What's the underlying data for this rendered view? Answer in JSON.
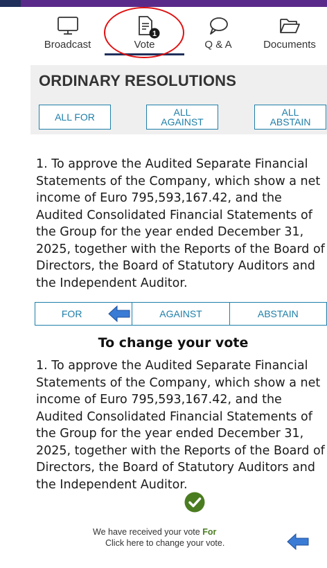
{
  "nav": {
    "items": [
      {
        "label": "Broadcast",
        "icon": "monitor-icon"
      },
      {
        "label": "Vote",
        "icon": "document-icon",
        "badge": "1",
        "active": true
      },
      {
        "label": "Q & A",
        "icon": "chat-bubble-icon"
      },
      {
        "label": "Documents",
        "icon": "folder-icon"
      }
    ]
  },
  "resolutions": {
    "title": "ORDINARY RESOLUTIONS",
    "all_for": "ALL FOR",
    "all_against": "ALL\nAGAINST",
    "all_abstain": "ALL\nABSTAIN"
  },
  "resolution1": {
    "text": "1. To approve the Audited Separate Financial Statements of the Company, which show a net income of Euro 795,593,167.42, and the Audited Consolidated Financial Statements of the Group for the year ended December 31, 2025, together with the Reports of the Board of Directors, the Board of Statutory Auditors and the Independent Auditor."
  },
  "vote_options": {
    "for": "FOR",
    "against": "AGAINST",
    "abstain": "ABSTAIN"
  },
  "change_heading": "To change your vote",
  "confirmation": {
    "prefix": "We have received your vote ",
    "vote": "For",
    "change_link": "Click here to change your vote."
  },
  "colors": {
    "accent": "#1e7ea8",
    "nav_active": "#1f2f5a",
    "highlight_circle": "#e01010",
    "check_green": "#4a7c20",
    "arrow_blue": "#3a7bd5"
  }
}
